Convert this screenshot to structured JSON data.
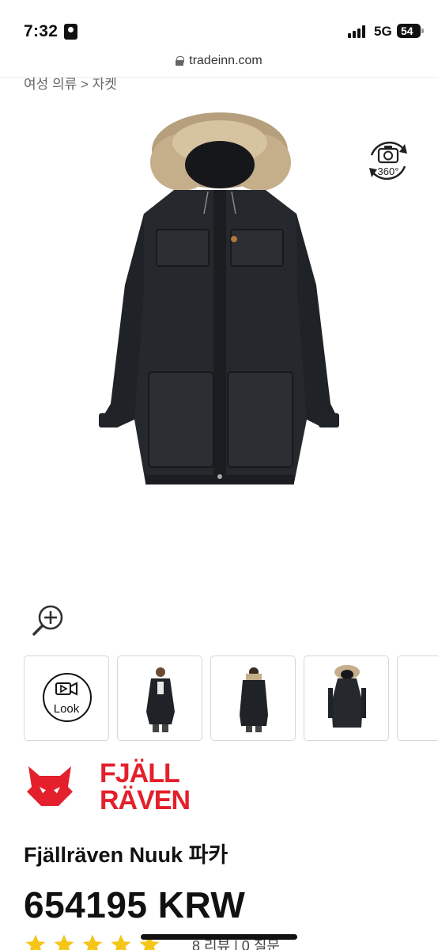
{
  "status_bar": {
    "time": "7:32",
    "network": "5G",
    "battery": "54"
  },
  "browser": {
    "url": "tradeinn.com"
  },
  "breadcrumb": "여성 의류 > 자켓",
  "product_image": {
    "alt": "Fjällräven Nuuk 파카"
  },
  "rotate_360_label": "360°",
  "thumbnails": {
    "video_label": "Look"
  },
  "brand": {
    "line1": "FJÄLL",
    "line2": "RÄVEN",
    "color": "#e3202b"
  },
  "product": {
    "title": "Fjällräven Nuuk 파카",
    "price": "654195 KRW"
  },
  "rating": {
    "stars": 5,
    "reviews_text": "8 리뷰 | 0 질문",
    "star_color": "#f5c518"
  }
}
